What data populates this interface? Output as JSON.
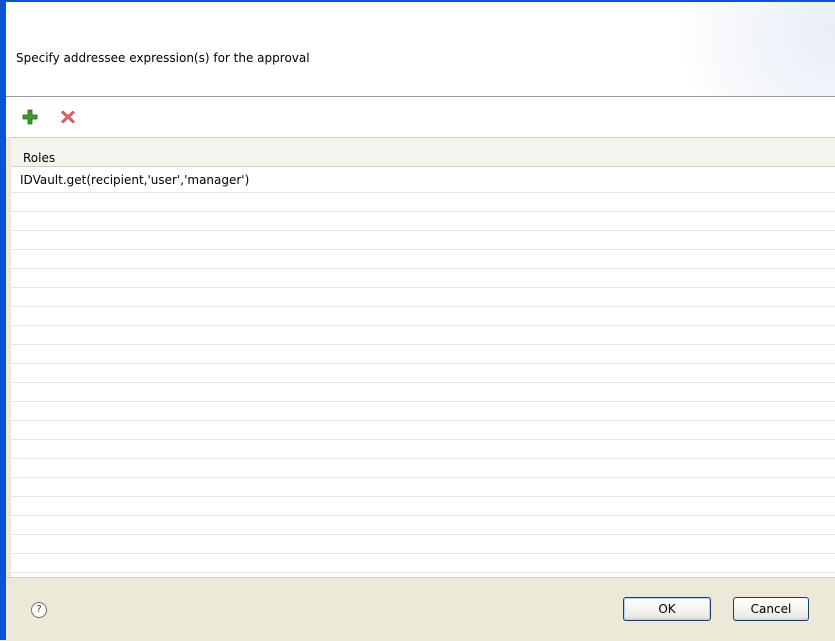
{
  "dialog": {
    "message": "Specify addressee expression(s) for the approval"
  },
  "toolbar": {
    "add_icon": "plus-icon",
    "remove_icon": "delete-x-icon",
    "colors": {
      "add": "#3c9a25",
      "remove": "#d9534f"
    }
  },
  "table": {
    "columns": [
      "Roles"
    ],
    "rows": [
      "IDVault.get(recipient,'user','manager')",
      "",
      "",
      "",
      "",
      "",
      "",
      "",
      "",
      "",
      "",
      "",
      "",
      "",
      "",
      "",
      "",
      "",
      "",
      "",
      "",
      ""
    ]
  },
  "footer": {
    "help_icon": "?",
    "ok_label": "OK",
    "cancel_label": "Cancel"
  }
}
